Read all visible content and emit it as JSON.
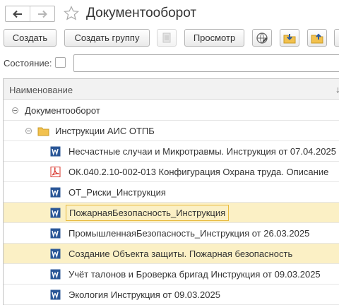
{
  "header": {
    "title": "Документооборот"
  },
  "toolbar": {
    "create": "Создать",
    "create_group": "Создать группу",
    "view": "Просмотр"
  },
  "filter": {
    "state_label": "Состояние:",
    "checked": false
  },
  "list": {
    "column_title": "Наименование",
    "sort_icon": "↓",
    "root": "Документооборот",
    "group": "Инструкции АИС ОТПБ",
    "items": [
      {
        "icon": "word-icon",
        "label": "Несчастные случаи и Микротравмы. Инструкция от 07.04.2025"
      },
      {
        "icon": "pdf-icon",
        "label": "ОК.040.2.10-002-013 Конфигурация Охрана труда. Описание"
      },
      {
        "icon": "word-icon",
        "label": "ОТ_Риски_Инструкция"
      },
      {
        "icon": "word-icon",
        "label": "ПожарнаяБезопасность_Инструкция",
        "current": true
      },
      {
        "icon": "word-icon",
        "label": "ПромышленнаяБезопасность_Инструкция от 26.03.2025"
      },
      {
        "icon": "word-icon",
        "label": "Создание Объекта защиты. Пожарная безопасность",
        "highlighted": true
      },
      {
        "icon": "word-icon",
        "label": "Учёт талонов и Броверка бригад Инструкция от 09.03.2025"
      },
      {
        "icon": "word-icon",
        "label": "Экология Инструкция от 09.03.2025"
      }
    ]
  },
  "colors": {
    "selected_row": "#fbf0c5",
    "current_border": "#e8b93a",
    "word_blue": "#2b5797",
    "pdf_red": "#d9342b",
    "folder": "#f2c14e"
  }
}
